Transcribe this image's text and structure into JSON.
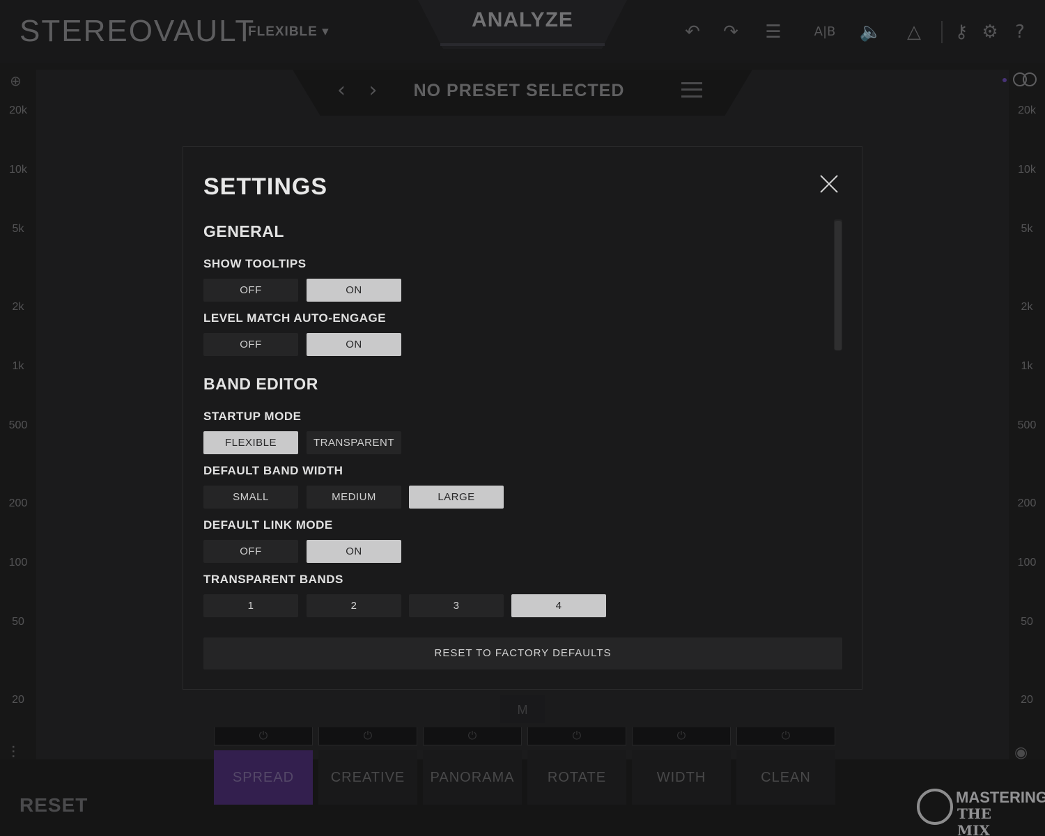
{
  "app": {
    "logo": "STEREOVAULT",
    "mode": "FLEXIBLE ▾",
    "analyze": "ANALYZE",
    "preset_name": "NO PRESET SELECTED",
    "reset": "RESET",
    "m_tab": "M",
    "freq_labels": [
      "20k",
      "10k",
      "5k",
      "2k",
      "1k",
      "500",
      "200",
      "100",
      "50",
      "20"
    ],
    "effects": [
      "SPREAD",
      "CREATIVE",
      "PANORAMA",
      "ROTATE",
      "WIDTH",
      "CLEAN"
    ],
    "active_effect": "SPREAD",
    "brand_top": "MASTERING",
    "brand_bottom": "THE MIX"
  },
  "toolbar_icons": [
    "undo-icon",
    "redo-icon",
    "history-icon",
    "ab-compare-icon",
    "mute-icon",
    "delta-icon",
    "key-icon",
    "gear-icon",
    "help-icon"
  ],
  "settings": {
    "title": "SETTINGS",
    "general": {
      "heading": "GENERAL",
      "show_tooltips": {
        "label": "SHOW TOOLTIPS",
        "off": "OFF",
        "on": "ON",
        "selected": "ON"
      },
      "level_match": {
        "label": "LEVEL MATCH AUTO-ENGAGE",
        "off": "OFF",
        "on": "ON",
        "selected": "ON"
      }
    },
    "band_editor": {
      "heading": "BAND EDITOR",
      "startup_mode": {
        "label": "STARTUP MODE",
        "flexible": "FLEXIBLE",
        "transparent": "TRANSPARENT",
        "selected": "FLEXIBLE"
      },
      "band_width": {
        "label": "DEFAULT BAND WIDTH",
        "small": "SMALL",
        "medium": "MEDIUM",
        "large": "LARGE",
        "selected": "LARGE"
      },
      "link_mode": {
        "label": "DEFAULT LINK MODE",
        "off": "OFF",
        "on": "ON",
        "selected": "ON"
      },
      "transparent_bands": {
        "label": "TRANSPARENT BANDS",
        "b1": "1",
        "b2": "2",
        "b3": "3",
        "b4": "4",
        "selected": "4"
      }
    },
    "reset_defaults": "RESET TO FACTORY DEFAULTS"
  }
}
